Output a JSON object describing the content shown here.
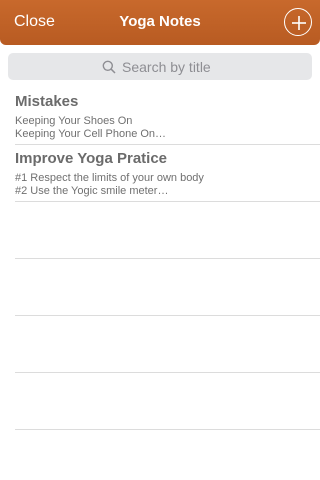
{
  "navbar": {
    "close_label": "Close",
    "title": "Yoga Notes",
    "add_icon": "plus-circle-icon",
    "background": "#bf6227"
  },
  "search": {
    "placeholder": "Search by title",
    "icon": "search-icon"
  },
  "notes": [
    {
      "title": "Mistakes",
      "line1": "Keeping Your Shoes On",
      "line2": "Keeping Your Cell Phone On…"
    },
    {
      "title": "Improve Yoga Pratice",
      "line1": "#1 Respect the limits of your own body",
      "line2": "#2 Use the Yogic smile meter…"
    }
  ]
}
